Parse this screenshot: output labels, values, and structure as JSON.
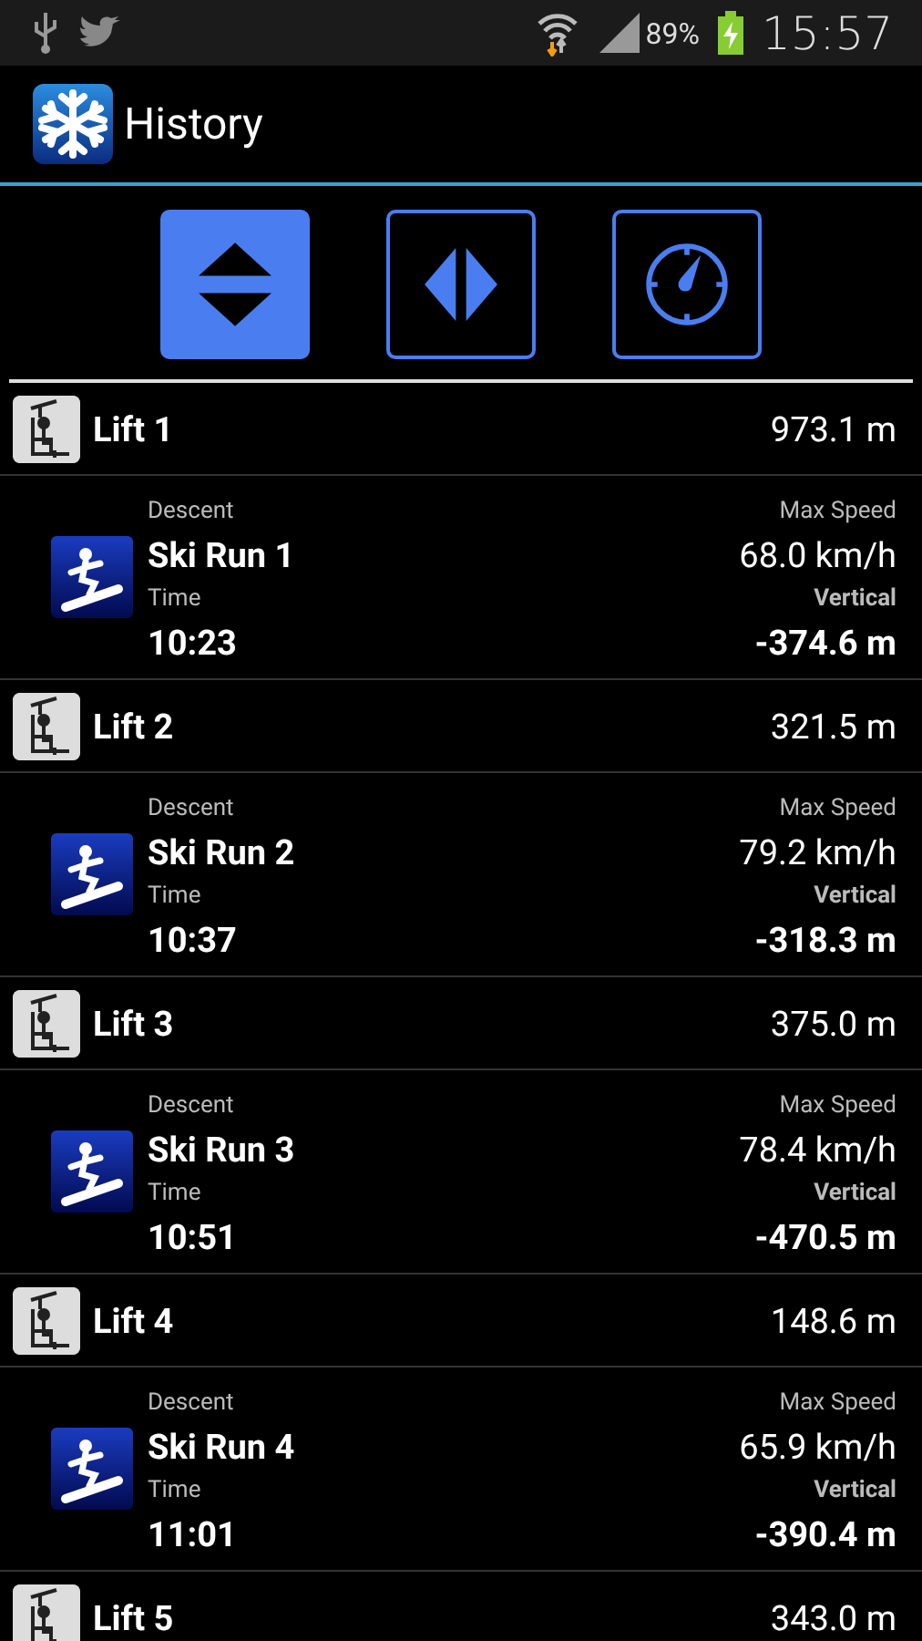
{
  "status_bar": {
    "battery": "89%",
    "time": "15:57"
  },
  "app_bar": {
    "title": "History"
  },
  "view_modes": [
    {
      "kind": "vertical",
      "selected": true
    },
    {
      "kind": "horizontal",
      "selected": false
    },
    {
      "kind": "speed",
      "selected": false
    }
  ],
  "history": [
    {
      "kind": "lift",
      "name": "Lift 1",
      "distance": "973.1 m"
    },
    {
      "kind": "run",
      "label": "Descent",
      "name": "Ski Run 1",
      "time_label": "Time",
      "time": "10:23",
      "speed_label": "Max Speed",
      "speed": "68.0 km/h",
      "vertical_label": "Vertical",
      "vertical": "-374.6 m"
    },
    {
      "kind": "lift",
      "name": "Lift 2",
      "distance": "321.5 m"
    },
    {
      "kind": "run",
      "label": "Descent",
      "name": "Ski Run 2",
      "time_label": "Time",
      "time": "10:37",
      "speed_label": "Max Speed",
      "speed": "79.2 km/h",
      "vertical_label": "Vertical",
      "vertical": "-318.3 m"
    },
    {
      "kind": "lift",
      "name": "Lift 3",
      "distance": "375.0 m"
    },
    {
      "kind": "run",
      "label": "Descent",
      "name": "Ski Run 3",
      "time_label": "Time",
      "time": "10:51",
      "speed_label": "Max Speed",
      "speed": "78.4 km/h",
      "vertical_label": "Vertical",
      "vertical": "-470.5 m"
    },
    {
      "kind": "lift",
      "name": "Lift 4",
      "distance": "148.6 m"
    },
    {
      "kind": "run",
      "label": "Descent",
      "name": "Ski Run 4",
      "time_label": "Time",
      "time": "11:01",
      "speed_label": "Max Speed",
      "speed": "65.9 km/h",
      "vertical_label": "Vertical",
      "vertical": "-390.4 m"
    },
    {
      "kind": "lift",
      "name": "Lift 5",
      "distance": "343.0 m"
    }
  ]
}
